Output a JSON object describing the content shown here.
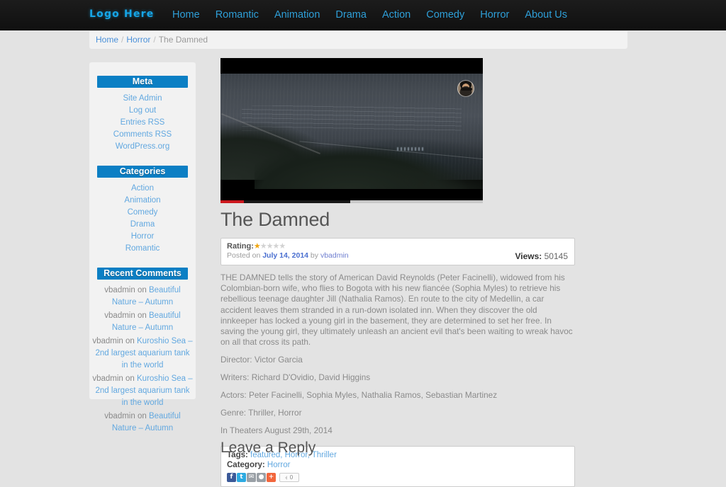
{
  "header": {
    "logo": "Logo Here",
    "nav": [
      {
        "label": "Home"
      },
      {
        "label": "Romantic"
      },
      {
        "label": "Animation"
      },
      {
        "label": "Drama"
      },
      {
        "label": "Action"
      },
      {
        "label": "Comedy"
      },
      {
        "label": "Horror"
      },
      {
        "label": "About Us"
      }
    ]
  },
  "breadcrumb": {
    "home": "Home",
    "sep1": "/",
    "category": "Horror",
    "sep2": "/",
    "current": "The Damned"
  },
  "sidebar": {
    "meta": {
      "title": "Meta",
      "items": [
        {
          "label": "Site Admin"
        },
        {
          "label": "Log out"
        },
        {
          "label": "Entries RSS"
        },
        {
          "label": "Comments RSS"
        },
        {
          "label": "WordPress.org"
        }
      ]
    },
    "categories": {
      "title": "Categories",
      "items": [
        {
          "label": "Action"
        },
        {
          "label": "Animation"
        },
        {
          "label": "Comedy"
        },
        {
          "label": "Drama"
        },
        {
          "label": "Horror"
        },
        {
          "label": "Romantic"
        }
      ]
    },
    "recent_comments": {
      "title": "Recent Comments",
      "items": [
        {
          "author": "vbadmin",
          "on": " on ",
          "post": "Beautiful Nature – Autumn"
        },
        {
          "author": "vbadmin",
          "on": " on ",
          "post": "Beautiful Nature – Autumn"
        },
        {
          "author": "vbadmin",
          "on": " on ",
          "post": "Kuroshio Sea – 2nd largest aquarium tank in the world"
        },
        {
          "author": "vbadmin",
          "on": " on ",
          "post": "Kuroshio Sea – 2nd largest aquarium tank in the world"
        },
        {
          "author": "vbadmin",
          "on": " on ",
          "post": "Beautiful Nature – Autumn"
        }
      ]
    }
  },
  "video": {
    "progress_played_percent": "9",
    "progress_loaded_percent": "49.5"
  },
  "post": {
    "title": "The Damned",
    "rating_label": "Rating:",
    "rating_value": 1,
    "rating_max": 5,
    "posted_prefix": "Posted on ",
    "date": "July 14, 2014",
    "by": " by ",
    "author": "vbadmin",
    "views_label": "Views:",
    "views_count": "50145",
    "description": "THE DAMNED tells the story of American David Reynolds (Peter Facinelli), widowed from his Colombian-born wife, who flies to Bogota with his new fiancée (Sophia Myles) to retrieve his rebellious teenage daughter Jill (Nathalia Ramos). En route to the city of Medellin, a car accident leaves them stranded in a run-down isolated inn. When they discover the old innkeeper has locked a young girl in the basement, they are determined to set her free. In saving the young girl, they ultimately unleash an ancient evil that's been waiting to wreak havoc on all that cross its path.",
    "credits": [
      {
        "text": "Director: Victor Garcia"
      },
      {
        "text": "Writers: Richard D'Ovidio, David Higgins"
      },
      {
        "text": "Actors: Peter Facinelli, Sophia Myles, Nathalia Ramos, Sebastian Martinez"
      },
      {
        "text": "Genre: Thriller, Horror"
      },
      {
        "text": "In Theaters August 29th, 2014"
      }
    ],
    "tags_label": "Tags:",
    "tags": "featured, Horror, Thriller",
    "category_label": "Category:",
    "category": "Horror",
    "share": {
      "facebook": "f",
      "twitter": "t",
      "email": "✉",
      "more": "●",
      "addthis": "+",
      "count": "0"
    }
  },
  "comments_section": {
    "title": "Leave a Reply"
  },
  "colors": {
    "accent_blue": "#0b7fc4",
    "link_blue": "#62a8e0",
    "nav_blue": "#2e9fd8",
    "logo_cyan": "#16a6e8",
    "star_gold": "#f0a50f",
    "youtube_red": "#cc181e",
    "page_bg": "#e3e3e3",
    "panel_bg": "#f2f2f2"
  }
}
